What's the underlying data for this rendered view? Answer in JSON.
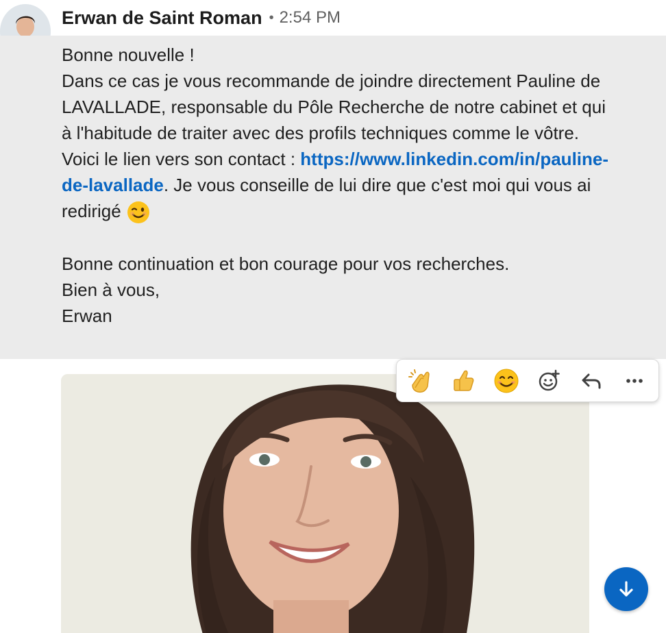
{
  "message": {
    "sender_name": "Erwan de Saint Roman",
    "separator": "•",
    "timestamp": "2:54 PM",
    "body_intro": "Bonne nouvelle !\nDans ce cas je vous recommande de joindre directement Pauline de LAVALLADE, responsable du Pôle Recherche de notre cabinet et qui à l'habitude de traiter avec des profils techniques comme le vôtre. Voici le lien vers son contact : ",
    "link_text": "https://www.linkedin.com/in/pauline-de-lavallade",
    "body_after_link": ". Je vous conseille de lui dire que c'est moi qui vous ai redirigé ",
    "emoji_icon": "winking-face-emoji",
    "body_outro": "\n\nBonne continuation et bon courage pour vos recherches.\nBien à vous,\nErwan"
  },
  "reactions": [
    {
      "name": "clapping-hands-emoji",
      "label": "Clap"
    },
    {
      "name": "thumbs-up-emoji",
      "label": "Like"
    },
    {
      "name": "smiling-face-emoji",
      "label": "Smile"
    },
    {
      "name": "add-reaction-icon",
      "label": "Add reaction"
    },
    {
      "name": "reply-icon",
      "label": "Reply"
    },
    {
      "name": "more-icon",
      "label": "More"
    }
  ],
  "colors": {
    "accent": "#0a66c2",
    "bubble_bg": "#ebebeb",
    "text": "#1f1f1f",
    "muted": "#5f5f5f"
  },
  "scroll_button_icon": "arrow-down-icon"
}
